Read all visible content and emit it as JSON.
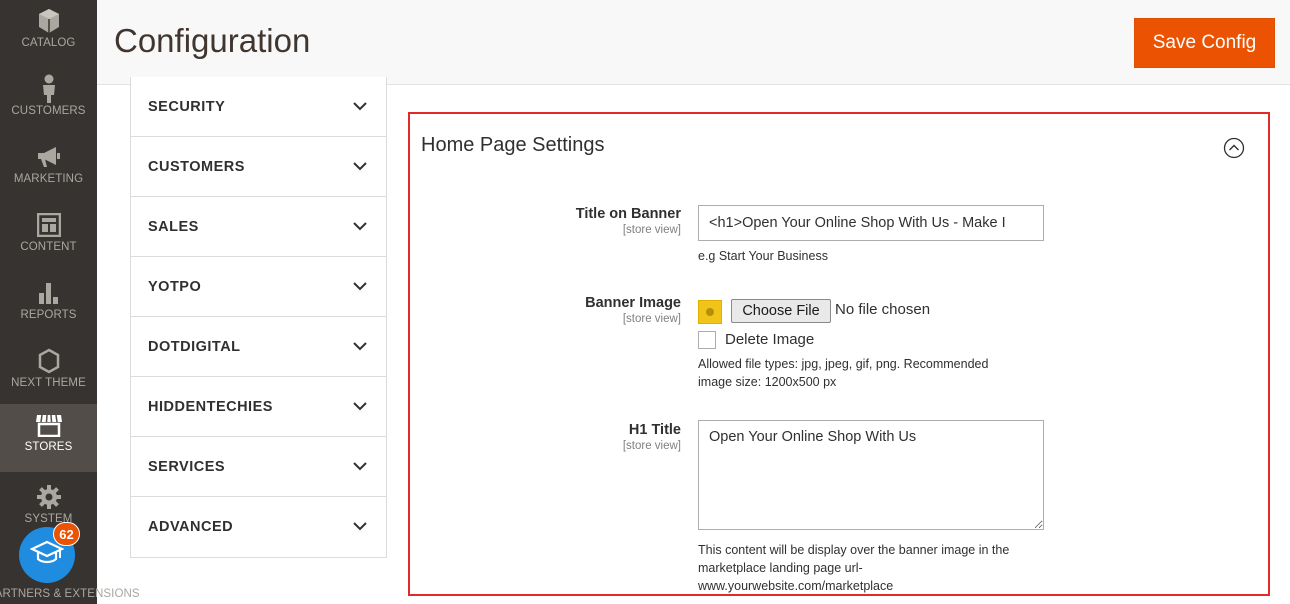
{
  "sidebar": {
    "items": [
      {
        "label": "CATALOG",
        "icon": "cube-icon"
      },
      {
        "label": "CUSTOMERS",
        "icon": "person-icon"
      },
      {
        "label": "MARKETING",
        "icon": "megaphone-icon"
      },
      {
        "label": "CONTENT",
        "icon": "layout-icon"
      },
      {
        "label": "REPORTS",
        "icon": "bar-chart-icon"
      },
      {
        "label": "NEXT THEME",
        "icon": "hexagon-icon"
      },
      {
        "label": "STORES",
        "icon": "storefront-icon"
      },
      {
        "label": "SYSTEM",
        "icon": "gear-icon"
      },
      {
        "label": "FIND PARTNERS & EXTENSIONS",
        "icon": "puzzle-icon"
      }
    ],
    "active": "STORES",
    "badge_count": "62"
  },
  "header": {
    "title": "Configuration",
    "save_label": "Save Config"
  },
  "tabs": [
    {
      "label": "SECURITY"
    },
    {
      "label": "CUSTOMERS"
    },
    {
      "label": "SALES"
    },
    {
      "label": "YOTPO"
    },
    {
      "label": "DOTDIGITAL"
    },
    {
      "label": "HIDDENTECHIES"
    },
    {
      "label": "SERVICES"
    },
    {
      "label": "ADVANCED"
    }
  ],
  "section": {
    "title": "Home Page Settings",
    "fields": {
      "banner_title": {
        "label": "Title on Banner",
        "scope": "[store view]",
        "value": "<h1>Open Your Online Shop With Us - Make I",
        "note": "e.g Start Your Business"
      },
      "banner_image": {
        "label": "Banner Image",
        "scope": "[store view]",
        "choose_label": "Choose File",
        "no_file": "No file chosen",
        "delete_label": "Delete Image",
        "note_line1": "Allowed file types: jpg, jpeg, gif, png. Recommended",
        "note_line2": "image size: 1200x500 px"
      },
      "h1_title": {
        "label": "H1 Title",
        "scope": "[store view]",
        "value": "Open Your Online Shop With Us",
        "note_line1": "This content will be display over the banner image in the",
        "note_line2": "marketplace landing page url-",
        "note_line3": "www.yourwebsite.com/marketplace"
      }
    }
  },
  "colors": {
    "sidebar_bg": "#373330",
    "accent": "#eb5202",
    "highlight_border": "#e02b27",
    "badge_blue": "#1f8ce0"
  }
}
